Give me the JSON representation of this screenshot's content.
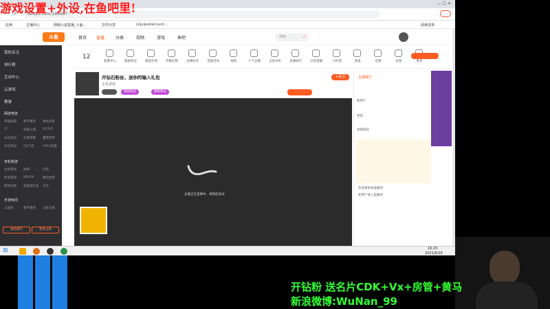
{
  "overlay": {
    "title": "游戏设置+外设,在鱼吧里!",
    "bottom_line1": "开钻粉 送名片CDK+Vx+房管+黄马",
    "bottom_line2": "新浪微博:WuNan_99"
  },
  "browser": {
    "url": "douyu.com/166697",
    "bookmarks": [
      "应用",
      "主播中心",
      "网络小说直播_斗鱼...",
      "文件分享",
      "LiquipediaCount..."
    ],
    "bookmark_right": "阅读清单"
  },
  "topnav": {
    "logo": "斗鱼",
    "items": [
      "首页",
      "直播",
      "分类",
      "视频",
      "游戏",
      "鱼吧"
    ],
    "active": "直播",
    "search_placeholder": "搜索"
  },
  "sidebar": {
    "main": [
      "我的关注",
      "排行榜",
      "互动中心",
      "云游戏",
      "赛事"
    ],
    "sections": [
      {
        "title": "网游竞技",
        "items": [
          "英雄联盟",
          "和平精英",
          "绝地求生",
          "CF",
          "穿越火线",
          "DOTA2",
          "永劫无间",
          "王者荣耀",
          "魔兽世界",
          "炉石传说",
          "QQ飞车",
          "APEX英雄"
        ]
      },
      {
        "title": "单机热游",
        "items": [
          "主机游戏",
          "原神",
          "幻塔",
          "怀旧游戏",
          "NBA2K",
          "我的世界",
          "使命召唤",
          "逃离塔科夫",
          "方舟"
        ]
      },
      {
        "title": "手游休闲",
        "items": [
          "三国杀",
          "和平精英",
          "火影忍者"
        ]
      }
    ],
    "btn_left": "鱼吧排行",
    "btn_right": "更多分类"
  },
  "catbar": {
    "count": "12",
    "items": [
      "能量中心",
      "超级粉丝",
      "赠送礼物",
      "开箱礼物",
      "主播任务",
      "宝箱活动",
      "福利",
      "人气主播",
      "全民SPK",
      "主播排行",
      "分享直播",
      "小铃铛",
      "发送",
      "竞猜",
      "房管",
      "更多"
    ]
  },
  "room": {
    "title": "开钻石粉丝，送你的输入礼包",
    "category": "主机游戏",
    "tags": [
      "我是粉丝",
      "超级粉丝"
    ],
    "follow": "关注",
    "btn_follow": "+关注"
  },
  "player": {
    "loading_text": "主播正在直播中，请稍后再试"
  },
  "rightpanel": {
    "tab": "主播排行",
    "items": [
      "新用户",
      "贵宾",
      "高级粉丝"
    ],
    "chat": [
      "欢迎来到本直播间",
      "新用户进入直播间",
      "礼物赠送"
    ]
  },
  "taskbar": {
    "time": "16:25",
    "date": "2021/6/29"
  },
  "colors": {
    "accent": "#ff5d23",
    "sidebar": "#2e2e33",
    "overlay_red": "#ff1a1a",
    "overlay_green": "#33ff33",
    "windows_blue": "#1e7fe0"
  }
}
